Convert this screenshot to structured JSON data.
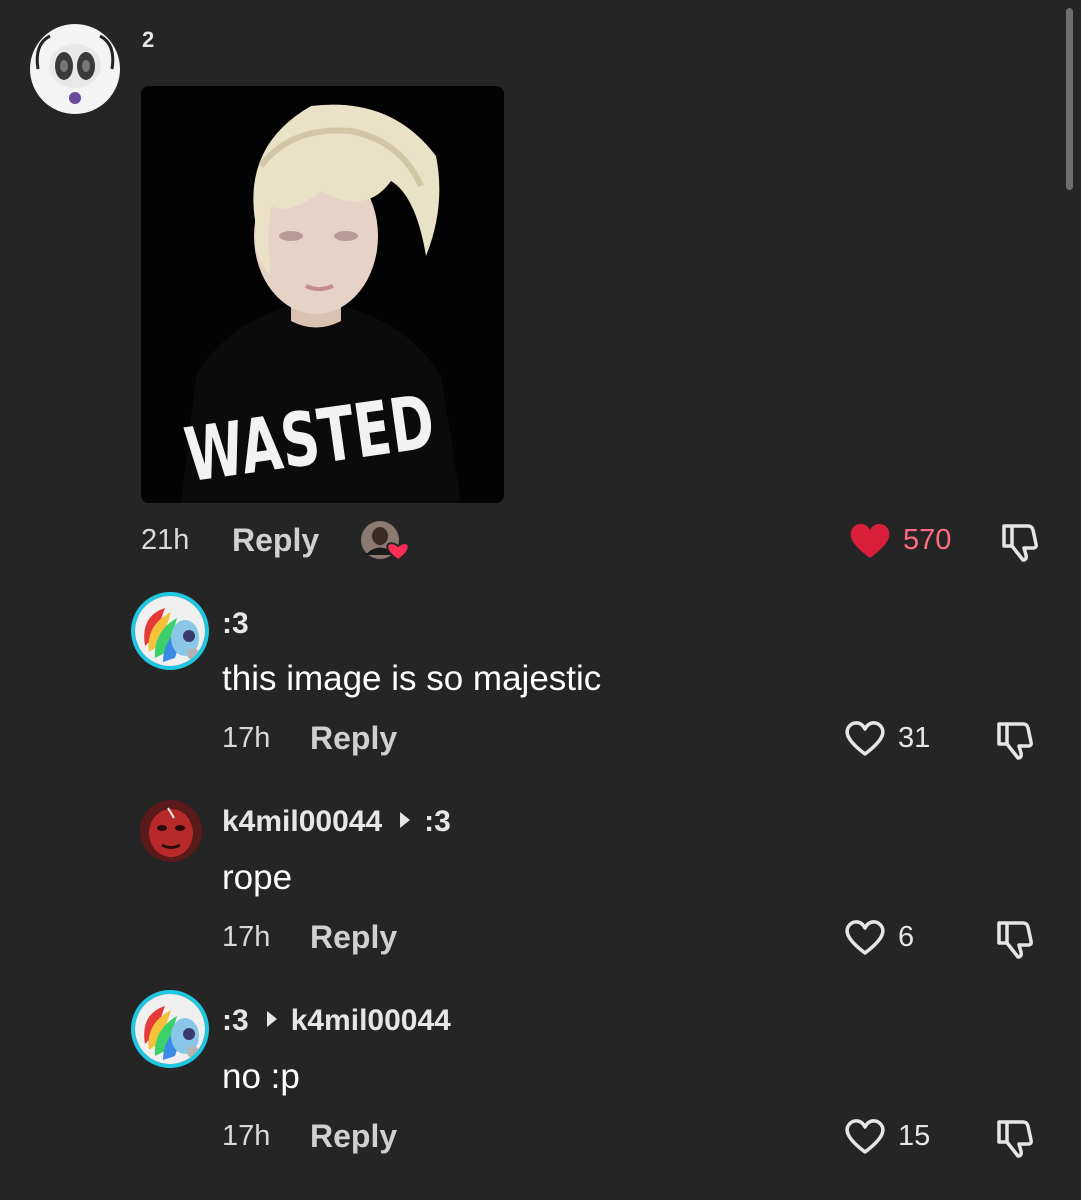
{
  "top_comment": {
    "username": "2",
    "image_alt_text": "WASTED",
    "time": "21h",
    "reply_label": "Reply",
    "likes": "570",
    "liked": true
  },
  "replies": [
    {
      "username": ":3",
      "reply_to": "",
      "text": "this image is so majestic",
      "time": "17h",
      "reply_label": "Reply",
      "likes": "31"
    },
    {
      "username": "k4mil00044",
      "reply_to": ":3",
      "text": "rope",
      "time": "17h",
      "reply_label": "Reply",
      "likes": "6"
    },
    {
      "username": ":3",
      "reply_to": "k4mil00044",
      "text": "no :p",
      "time": "17h",
      "reply_label": "Reply",
      "likes": "15"
    }
  ],
  "colors": {
    "background": "#252525",
    "liked_heart": "#d91e3a",
    "liked_count": "#ff6b81",
    "story_ring": "#1ec8e0"
  },
  "icons": {
    "like": "heart-outline-icon",
    "liked": "heart-filled-icon",
    "dislike": "thumbs-down-icon",
    "reply_arrow": "triangle-right-icon"
  }
}
